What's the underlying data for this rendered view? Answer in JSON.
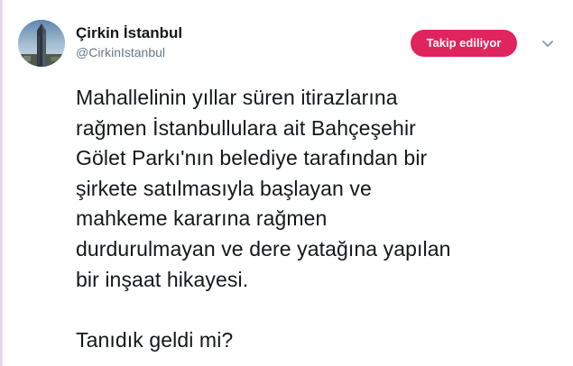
{
  "tweet": {
    "author": {
      "display_name": "Çirkin İstanbul",
      "handle": "@CirkinIstanbul",
      "avatar_icon": "skyscraper-photo-avatar"
    },
    "follow_button": {
      "label": "Takip ediliyor",
      "color": "#e0245e"
    },
    "menu_icon": "chevron-down-icon",
    "text": "Mahallelinin yıllar süren itirazlarına\nrağmen İstanbullulara ait Bahçeşehir\nGölet Parkı'nın belediye tarafından bir\nşirkete satılmasıyla başlayan ve\nmahkeme kararına rağmen\ndurdurulmayan ve dere yatağına yapılan\nbir inşaat hikayesi.\n\nTanıdık geldi mi?"
  },
  "colors": {
    "text_primary": "#14171a",
    "text_secondary": "#657786",
    "accent_bar": "#e6d6f0"
  }
}
